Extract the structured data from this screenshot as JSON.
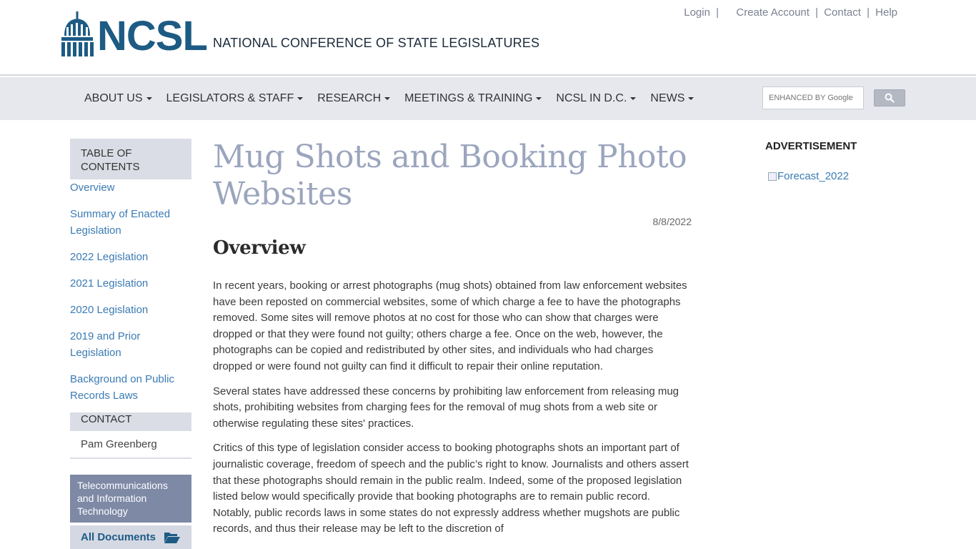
{
  "header": {
    "logo_text": "NCSL",
    "tagline": "NATIONAL CONFERENCE OF STATE LEGISLATURES",
    "links": {
      "login": "Login",
      "create_account": "Create Account",
      "contact": "Contact",
      "help": "Help",
      "separator": "|"
    }
  },
  "nav": {
    "items": [
      {
        "label": "ABOUT US"
      },
      {
        "label": "LEGISLATORS & STAFF"
      },
      {
        "label": "RESEARCH"
      },
      {
        "label": "MEETINGS & TRAINING"
      },
      {
        "label": "NCSL IN D.C."
      },
      {
        "label": "NEWS"
      }
    ],
    "search": {
      "placeholder": "ENHANCED BY Google",
      "button_icon": "search-icon"
    }
  },
  "sidebar": {
    "toc_title": "TABLE OF CONTENTS",
    "toc_items": [
      {
        "label": "Overview"
      },
      {
        "label": "Summary of Enacted Legislation"
      },
      {
        "label": "2022 Legislation"
      },
      {
        "label": "2021 Legislation"
      },
      {
        "label": "2020 Legislation"
      },
      {
        "label": "2019 and Prior Legislation"
      },
      {
        "label": "Background on Public Records Laws"
      }
    ],
    "contact_title": "CONTACT",
    "contact_name": "Pam Greenberg",
    "topic": "Telecommunications and Information Technology",
    "all_documents": "All Documents"
  },
  "main": {
    "title": "Mug Shots and Booking Photo Websites",
    "date": "8/8/2022",
    "section_title": "Overview",
    "paragraphs": [
      "In recent years, booking or arrest photographs (mug shots) obtained from law enforcement websites have been reposted on commercial websites, some of which charge a fee to have the photographs removed. Some sites will remove photos at no cost for those who can show that charges were dropped or that they were found not guilty; others charge a fee. Once on the web, however, the photographs can be copied and redistributed by other sites, and individuals who had charges dropped or were found not guilty can find it difficult to repair their online reputation.",
      "Several states have addressed these concerns by prohibiting law enforcement from releasing mug shots, prohibiting websites from charging fees for the removal of mug shots from a web site or otherwise regulating these sites' practices.",
      "Critics of this type of legislation consider access to booking photographs shots an important part of journalistic coverage, freedom of speech and the public’s right to know. Journalists and others assert that these photographs should remain in the public realm. Indeed, some of the proposed legislation listed below would specifically provide that booking photographs are to remain public record. Notably, public records laws in some states do not expressly address whether mugshots are public records, and thus their release may be  left to the discretion of"
    ]
  },
  "right": {
    "ad_label": "ADVERTISEMENT",
    "ad_alt": "Forecast_2022"
  },
  "colors": {
    "brand_blue": "#1d5b84",
    "link_blue": "#3b7bb4",
    "title_gray": "#9ba5bd",
    "nav_bg": "#e6e8ee",
    "sidebar_topic_bg": "#7e89a6"
  }
}
